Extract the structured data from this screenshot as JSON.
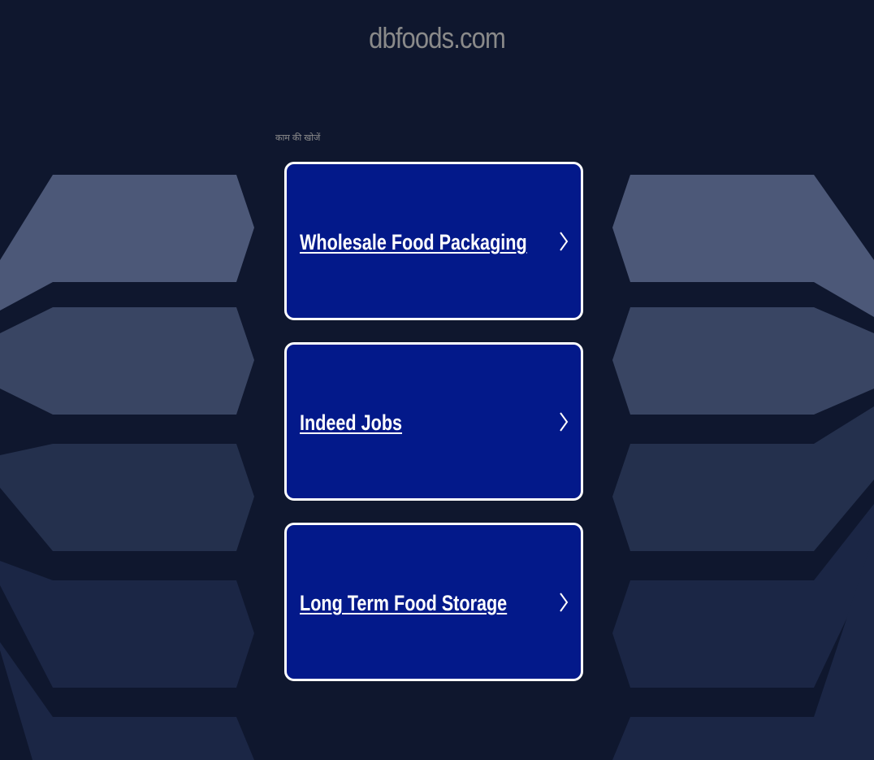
{
  "site": {
    "domain": "dbfoods.com",
    "search_caption": "काम की खोजें"
  },
  "links": [
    {
      "label": "Wholesale Food Packaging",
      "icon": "chevron-right-icon"
    },
    {
      "label": "Indeed Jobs",
      "icon": "chevron-right-icon"
    },
    {
      "label": "Long Term Food Storage",
      "icon": "chevron-right-icon"
    }
  ],
  "colors": {
    "background": "#0f172e",
    "card_fill": "#03198a",
    "card_border": "#ffffff",
    "title_text": "#8a8a8a",
    "shape_light": "#4c5878",
    "shape_mid": "#394563",
    "shape_dark": "#24304d",
    "shape_darker": "#1b2645"
  }
}
